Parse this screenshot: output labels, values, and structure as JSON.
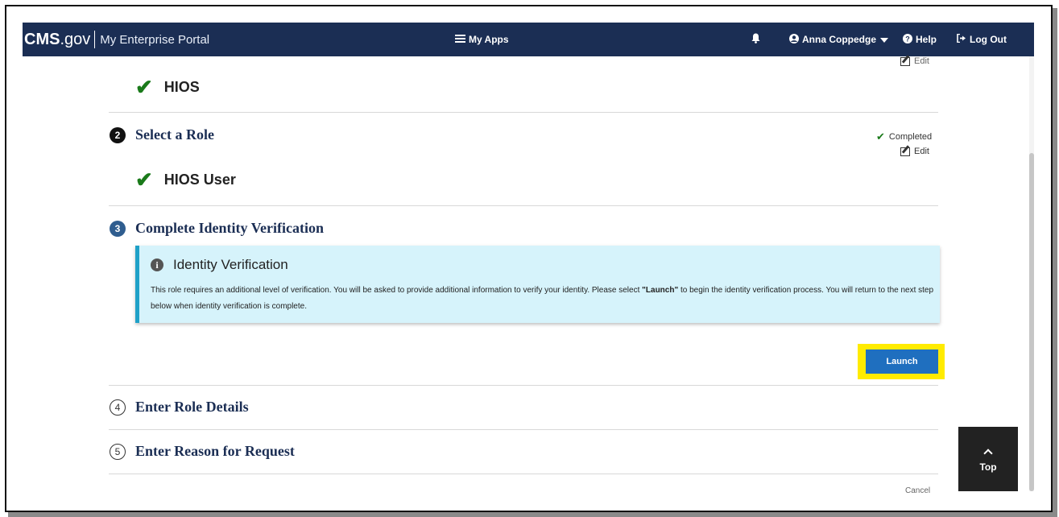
{
  "navbar": {
    "brand_cms": "CMS",
    "brand_gov": ".gov",
    "portal": "My Enterprise Portal",
    "my_apps": "My Apps",
    "user": "Anna Coppedge",
    "help": "Help",
    "logout": "Log Out"
  },
  "step1": {
    "app": "HIOS",
    "edit": "Edit"
  },
  "step2": {
    "number": "2",
    "title": "Select a Role",
    "status": "Completed",
    "edit": "Edit",
    "role": "HIOS User"
  },
  "step3": {
    "number": "3",
    "title": "Complete Identity Verification",
    "alert_title": "Identity Verification",
    "alert_text_1": "This role requires an additional level of verification. You will be asked to provide additional information to verify your identity. Please select ",
    "alert_text_bold": "\"Launch\"",
    "alert_text_2": " to begin the identity verification process. You will return to the next step below when identity verification is complete.",
    "launch": "Launch"
  },
  "step4": {
    "number": "4",
    "title": "Enter Role Details"
  },
  "step5": {
    "number": "5",
    "title": "Enter Reason for Request"
  },
  "footer": {
    "cancel": "Cancel"
  },
  "top_button": "Top",
  "colors": {
    "navbar": "#1b2e54",
    "step_title": "#1b2e54",
    "check_green": "#1a7a1a",
    "alert_bg": "#d6f3fb",
    "alert_border": "#1fa1c8",
    "launch_button": "#1f6fbf",
    "highlight": "#ffeb00"
  }
}
